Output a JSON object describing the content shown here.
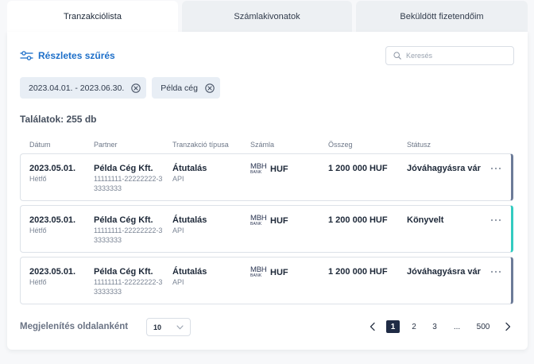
{
  "theme": {
    "accent": "#1d6fc9",
    "text": "#1d2838",
    "muted_text": "#7b8595",
    "chip_bg": "#e8eef5",
    "active_page_bg": "#1f2b45"
  },
  "tabs": [
    {
      "label": "Tranzakciólista",
      "active": true
    },
    {
      "label": "Számlakivonatok",
      "active": false
    },
    {
      "label": "Beküldött fizetendőim",
      "active": false
    }
  ],
  "filter": {
    "label": "Részletes szűrés",
    "icon": "sliders-icon"
  },
  "search": {
    "placeholder": "Keresés",
    "value": "",
    "icon": "search-icon"
  },
  "active_filters": [
    {
      "label": "2023.04.01. - 2023.06.30.",
      "remove_icon": "close-circle-icon"
    },
    {
      "label": "Példa cég",
      "remove_icon": "close-circle-icon"
    }
  ],
  "results": {
    "label": "Találatok: 255 db"
  },
  "table": {
    "headers": {
      "date": "Dátum",
      "partner": "Partner",
      "type": "Tranzakció típusa",
      "account": "Számla",
      "amount": "Összeg",
      "status": "Státusz"
    },
    "rows": [
      {
        "date": "2023.05.01.",
        "weekday": "Hétfő",
        "partner": {
          "name": "Példa Cég Kft.",
          "account": "11111111-22222222-33333333"
        },
        "type": {
          "label": "Átutalás",
          "channel": "API"
        },
        "account": {
          "bank_logo_top": "MBH",
          "bank_logo_bottom": "BANK",
          "currency": "HUF"
        },
        "amount": "1 200 000 HUF",
        "status": "Jóváhagyásra vár",
        "status_color": "#6c7b98",
        "menu_icon": "more-horizontal-icon"
      },
      {
        "date": "2023.05.01.",
        "weekday": "Hétfő",
        "partner": {
          "name": "Példa Cég Kft.",
          "account": "11111111-22222222-33333333"
        },
        "type": {
          "label": "Átutalás",
          "channel": "API"
        },
        "account": {
          "bank_logo_top": "MBH",
          "bank_logo_bottom": "BANK",
          "currency": "HUF"
        },
        "amount": "1 200 000 HUF",
        "status": "Könyvelt",
        "status_color": "#33cbc0",
        "menu_icon": "more-horizontal-icon"
      },
      {
        "date": "2023.05.01.",
        "weekday": "Hétfő",
        "partner": {
          "name": "Példa Cég Kft.",
          "account": "11111111-22222222-33333333"
        },
        "type": {
          "label": "Átutalás",
          "channel": "API"
        },
        "account": {
          "bank_logo_top": "MBH",
          "bank_logo_bottom": "BANK",
          "currency": "HUF"
        },
        "amount": "1 200 000 HUF",
        "status": "Jóváhagyásra vár",
        "status_color": "#6c7b98",
        "menu_icon": "more-horizontal-icon"
      }
    ]
  },
  "pagination": {
    "per_page_label": "Megjelenítés oldalanként",
    "per_page_value": "10",
    "per_page_icon": "chevron-down-icon",
    "prev_icon": "chevron-left-icon",
    "next_icon": "chevron-right-icon",
    "pages": [
      {
        "label": "1",
        "active": true
      },
      {
        "label": "2",
        "active": false
      },
      {
        "label": "3",
        "active": false
      },
      {
        "label": "...",
        "active": false
      },
      {
        "label": "500",
        "active": false
      }
    ]
  }
}
